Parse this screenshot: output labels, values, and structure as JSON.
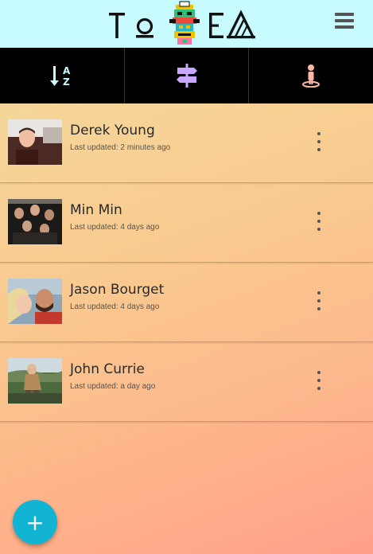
{
  "app": {
    "logo_text": "TOTEM"
  },
  "header": {
    "menu_icon": "hamburger-menu-icon"
  },
  "toolbar": {
    "items": [
      {
        "icon": "sort-alpha-icon",
        "color": "#c8fbff"
      },
      {
        "icon": "signpost-icon",
        "color": "#c9a6ff"
      },
      {
        "icon": "person-location-icon",
        "color": "#ffb8a6"
      }
    ]
  },
  "contacts": [
    {
      "name": "Derek Young",
      "updated": "Last updated: 2 minutes ago"
    },
    {
      "name": "Min Min",
      "updated": "Last updated: 4 days ago"
    },
    {
      "name": "Jason Bourget",
      "updated": "Last updated: 4 days ago"
    },
    {
      "name": "John Currie",
      "updated": "Last updated: a day ago"
    }
  ],
  "fab": {
    "label": "+",
    "color": "#11b4d3"
  },
  "colors": {
    "header_bg": "#c8fbff",
    "toolbar_bg": "#000000"
  }
}
